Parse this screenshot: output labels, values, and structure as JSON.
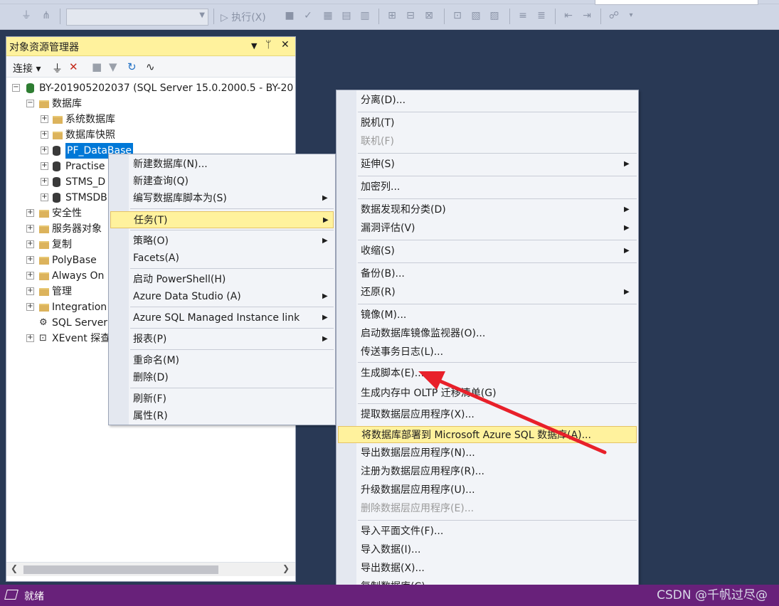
{
  "toolbar": {
    "execute_label": "执行(X)"
  },
  "object_explorer": {
    "title": "对象资源管理器",
    "title_controls": [
      "▾",
      "📌",
      "✕"
    ],
    "connect_label": "连接",
    "tree": [
      {
        "label": "BY-201905202037 (SQL Server 15.0.2000.5 - BY-20",
        "icon": "server-icon"
      },
      {
        "label": "数据库",
        "icon": "folder-icon"
      },
      {
        "label": "系统数据库",
        "icon": "folder-icon"
      },
      {
        "label": "数据库快照",
        "icon": "folder-icon"
      },
      {
        "label": "PF_DataBase",
        "icon": "database-icon",
        "selected": true
      },
      {
        "label": "Practise",
        "icon": "database-icon"
      },
      {
        "label": "STMS_D",
        "icon": "database-icon"
      },
      {
        "label": "STMSDB",
        "icon": "database-icon"
      },
      {
        "label": "安全性",
        "icon": "folder-icon"
      },
      {
        "label": "服务器对象",
        "icon": "folder-icon"
      },
      {
        "label": "复制",
        "icon": "folder-icon"
      },
      {
        "label": "PolyBase",
        "icon": "folder-icon"
      },
      {
        "label": "Always On",
        "icon": "folder-icon"
      },
      {
        "label": "管理",
        "icon": "folder-icon"
      },
      {
        "label": "Integration",
        "icon": "folder-icon"
      },
      {
        "label": "SQL Server",
        "icon": "agent-icon"
      },
      {
        "label": "XEvent 探查",
        "icon": "xevent-icon"
      }
    ]
  },
  "context_menu": [
    {
      "label": "新建数据库(N)..."
    },
    {
      "label": "新建查询(Q)"
    },
    {
      "label": "编写数据库脚本为(S)",
      "submenu": true
    },
    {
      "label": "任务(T)",
      "submenu": true,
      "highlighted": true
    },
    {
      "label": "策略(O)",
      "submenu": true
    },
    {
      "label": "Facets(A)"
    },
    {
      "label": "启动 PowerShell(H)"
    },
    {
      "label": "Azure Data Studio (A)",
      "submenu": true
    },
    {
      "label": "Azure SQL Managed Instance link",
      "submenu": true
    },
    {
      "label": "报表(P)",
      "submenu": true
    },
    {
      "label": "重命名(M)"
    },
    {
      "label": "删除(D)"
    },
    {
      "label": "刷新(F)"
    },
    {
      "label": "属性(R)"
    }
  ],
  "tasks_menu": [
    {
      "label": "分离(D)..."
    },
    {
      "label": "脱机(T)"
    },
    {
      "label": "联机(F)",
      "disabled": true
    },
    {
      "label": "延伸(S)",
      "submenu": true
    },
    {
      "label": "加密列..."
    },
    {
      "label": "数据发现和分类(D)",
      "submenu": true
    },
    {
      "label": "漏洞评估(V)",
      "submenu": true
    },
    {
      "label": "收缩(S)",
      "submenu": true
    },
    {
      "label": "备份(B)..."
    },
    {
      "label": "还原(R)",
      "submenu": true
    },
    {
      "label": "镜像(M)..."
    },
    {
      "label": "启动数据库镜像监视器(O)..."
    },
    {
      "label": "传送事务日志(L)..."
    },
    {
      "label": "生成脚本(E)..."
    },
    {
      "label": "生成内存中 OLTP 迁移清单(G)"
    },
    {
      "label": "提取数据层应用程序(X)..."
    },
    {
      "label": "将数据库部署到 Microsoft Azure SQL 数据库(A)...",
      "highlighted": true
    },
    {
      "label": "导出数据层应用程序(N)..."
    },
    {
      "label": "注册为数据层应用程序(R)..."
    },
    {
      "label": "升级数据层应用程序(U)..."
    },
    {
      "label": "删除数据层应用程序(E)...",
      "disabled": true
    },
    {
      "label": "导入平面文件(F)..."
    },
    {
      "label": "导入数据(I)..."
    },
    {
      "label": "导出数据(X)..."
    },
    {
      "label": "复制数据库(C)..."
    }
  ],
  "status": {
    "ready": "就绪"
  },
  "watermark": "CSDN @千帆过尽@",
  "colors": {
    "background": "#293955",
    "statusbar": "#68217a",
    "highlight": "#fff29d",
    "selection": "#0078d7",
    "annotation_arrow": "#e8202a"
  }
}
